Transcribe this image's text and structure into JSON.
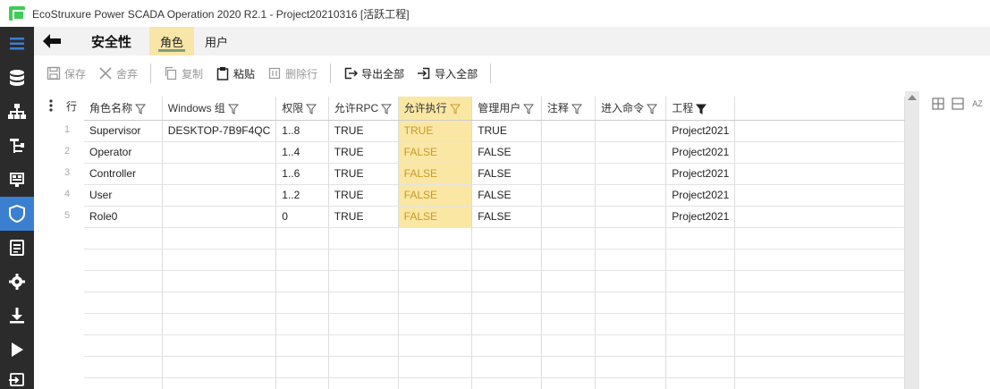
{
  "window": {
    "title": "EcoStruxure Power SCADA Operation 2020 R2.1 - Project20210316 [活跃工程]"
  },
  "rail": {
    "items": [
      {
        "icon": "menu-icon"
      },
      {
        "icon": "database-icon"
      },
      {
        "icon": "topology-icon"
      },
      {
        "icon": "device-tree-icon"
      },
      {
        "icon": "display-icon"
      },
      {
        "icon": "shield-icon"
      },
      {
        "icon": "document-icon"
      },
      {
        "icon": "gear-icon"
      },
      {
        "icon": "download-icon"
      },
      {
        "icon": "play-icon"
      },
      {
        "icon": "export-icon"
      }
    ],
    "active_index": 5
  },
  "header": {
    "page_title": "安全性",
    "tabs": [
      {
        "label": "角色",
        "selected": true
      },
      {
        "label": "用户",
        "selected": false
      }
    ]
  },
  "toolbar": {
    "save": "保存",
    "discard": "舍弃",
    "copy": "复制",
    "paste": "粘贴",
    "delete_row": "删除行",
    "export_all": "导出全部",
    "import_all": "导入全部"
  },
  "grid": {
    "row_header": "行",
    "columns": [
      "角色名称",
      "Windows 组",
      "权限",
      "允许RPC",
      "允许执行",
      "管理用户",
      "注释",
      "进入命令",
      "工程"
    ],
    "rows": [
      {
        "num": "1",
        "cells": [
          "Supervisor",
          "DESKTOP-7B9F4QC",
          "1..8",
          "TRUE",
          "TRUE",
          "TRUE",
          "",
          "",
          "Project2021"
        ]
      },
      {
        "num": "2",
        "cells": [
          "Operator",
          "",
          "1..4",
          "TRUE",
          "FALSE",
          "FALSE",
          "",
          "",
          "Project2021"
        ]
      },
      {
        "num": "3",
        "cells": [
          "Controller",
          "",
          "1..6",
          "TRUE",
          "FALSE",
          "FALSE",
          "",
          "",
          "Project2021"
        ]
      },
      {
        "num": "4",
        "cells": [
          "User",
          "",
          "1..2",
          "TRUE",
          "FALSE",
          "FALSE",
          "",
          "",
          "Project2021"
        ]
      },
      {
        "num": "5",
        "cells": [
          "Role0",
          "",
          "0",
          "TRUE",
          "FALSE",
          "FALSE",
          "",
          "",
          "Project2021"
        ]
      }
    ],
    "highlight_column": 4
  },
  "side_tools": {
    "az_label": "AZ"
  },
  "colors": {
    "rail_bg": "#2b2b2b",
    "rail_active": "#3b7fd0",
    "highlight": "#fbe7a4",
    "highlight_text": "#c59a2a"
  }
}
